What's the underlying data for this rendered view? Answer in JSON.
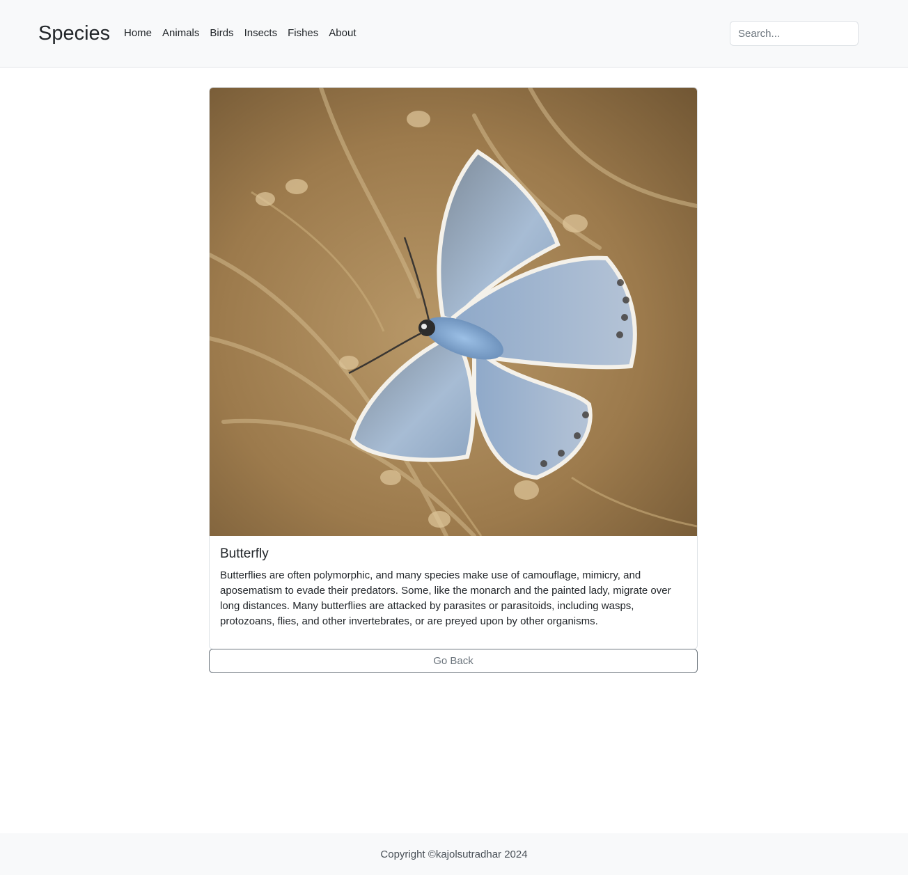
{
  "navbar": {
    "brand": "Species",
    "links": [
      {
        "label": "Home"
      },
      {
        "label": "Animals"
      },
      {
        "label": "Birds"
      },
      {
        "label": "Insects"
      },
      {
        "label": "Fishes"
      },
      {
        "label": "About"
      }
    ],
    "search": {
      "placeholder": "Search...",
      "value": ""
    }
  },
  "card": {
    "image_alt": "Butterfly",
    "title": "Butterfly",
    "description": "Butterflies are often polymorphic, and many species make use of camouflage, mimicry, and aposematism to evade their predators. Some, like the monarch and the painted lady, migrate over long distances. Many butterflies are attacked by parasites or parasitoids, including wasps, protozoans, flies, and other invertebrates, or are preyed upon by other organisms."
  },
  "back_button": {
    "label": "Go Back"
  },
  "footer": {
    "text": "Copyright ©kajolsutradhar 2024"
  },
  "colors": {
    "navbar_bg": "#f8f9fa",
    "text": "#212529",
    "muted": "#6c757d"
  }
}
